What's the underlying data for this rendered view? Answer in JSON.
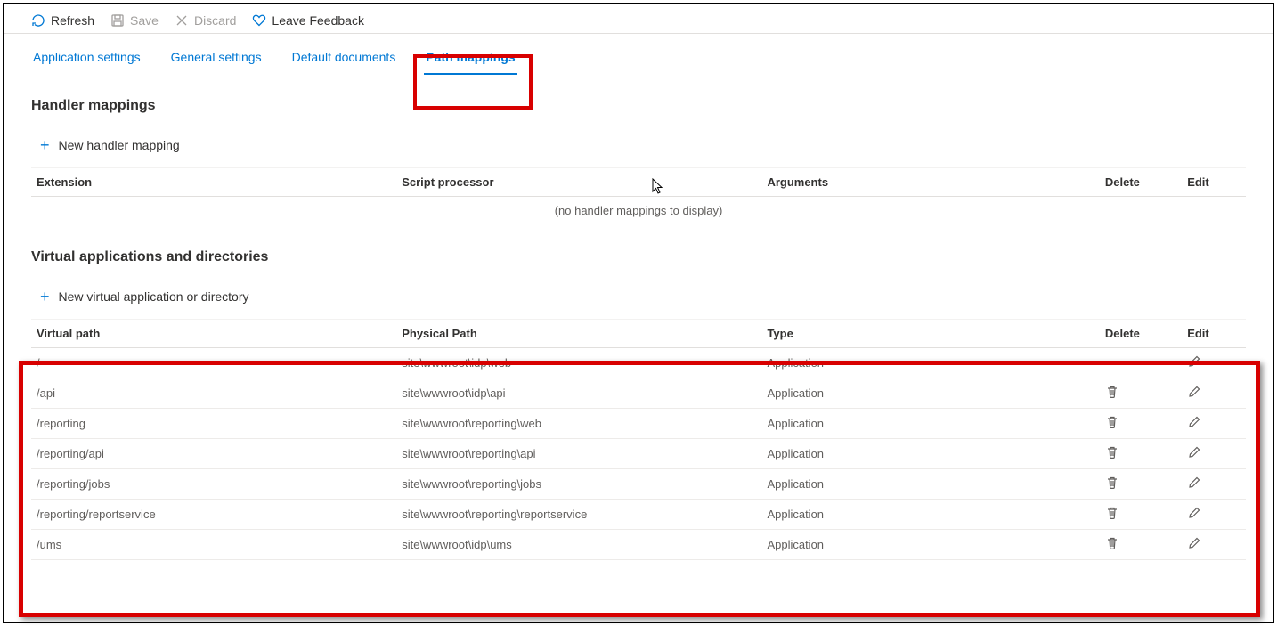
{
  "toolbar": {
    "refresh": "Refresh",
    "save": "Save",
    "discard": "Discard",
    "feedback": "Leave Feedback"
  },
  "tabs": [
    "Application settings",
    "General settings",
    "Default documents",
    "Path mappings"
  ],
  "active_tab_index": 3,
  "section_handler": {
    "title": "Handler mappings",
    "add_label": "New handler mapping",
    "columns": {
      "ext": "Extension",
      "script": "Script processor",
      "args": "Arguments",
      "del": "Delete",
      "edit": "Edit"
    },
    "empty": "(no handler mappings to display)"
  },
  "section_virtual": {
    "title": "Virtual applications and directories",
    "add_label": "New virtual application or directory",
    "columns": {
      "vpath": "Virtual path",
      "ppath": "Physical Path",
      "type": "Type",
      "del": "Delete",
      "edit": "Edit"
    },
    "rows": [
      {
        "vpath": "/",
        "ppath": "site\\wwwroot\\idp\\web",
        "type": "Application",
        "deletable": false
      },
      {
        "vpath": "/api",
        "ppath": "site\\wwwroot\\idp\\api",
        "type": "Application",
        "deletable": true
      },
      {
        "vpath": "/reporting",
        "ppath": "site\\wwwroot\\reporting\\web",
        "type": "Application",
        "deletable": true
      },
      {
        "vpath": "/reporting/api",
        "ppath": "site\\wwwroot\\reporting\\api",
        "type": "Application",
        "deletable": true
      },
      {
        "vpath": "/reporting/jobs",
        "ppath": "site\\wwwroot\\reporting\\jobs",
        "type": "Application",
        "deletable": true
      },
      {
        "vpath": "/reporting/reportservice",
        "ppath": "site\\wwwroot\\reporting\\reportservice",
        "type": "Application",
        "deletable": true
      },
      {
        "vpath": "/ums",
        "ppath": "site\\wwwroot\\idp\\ums",
        "type": "Application",
        "deletable": true
      }
    ]
  }
}
